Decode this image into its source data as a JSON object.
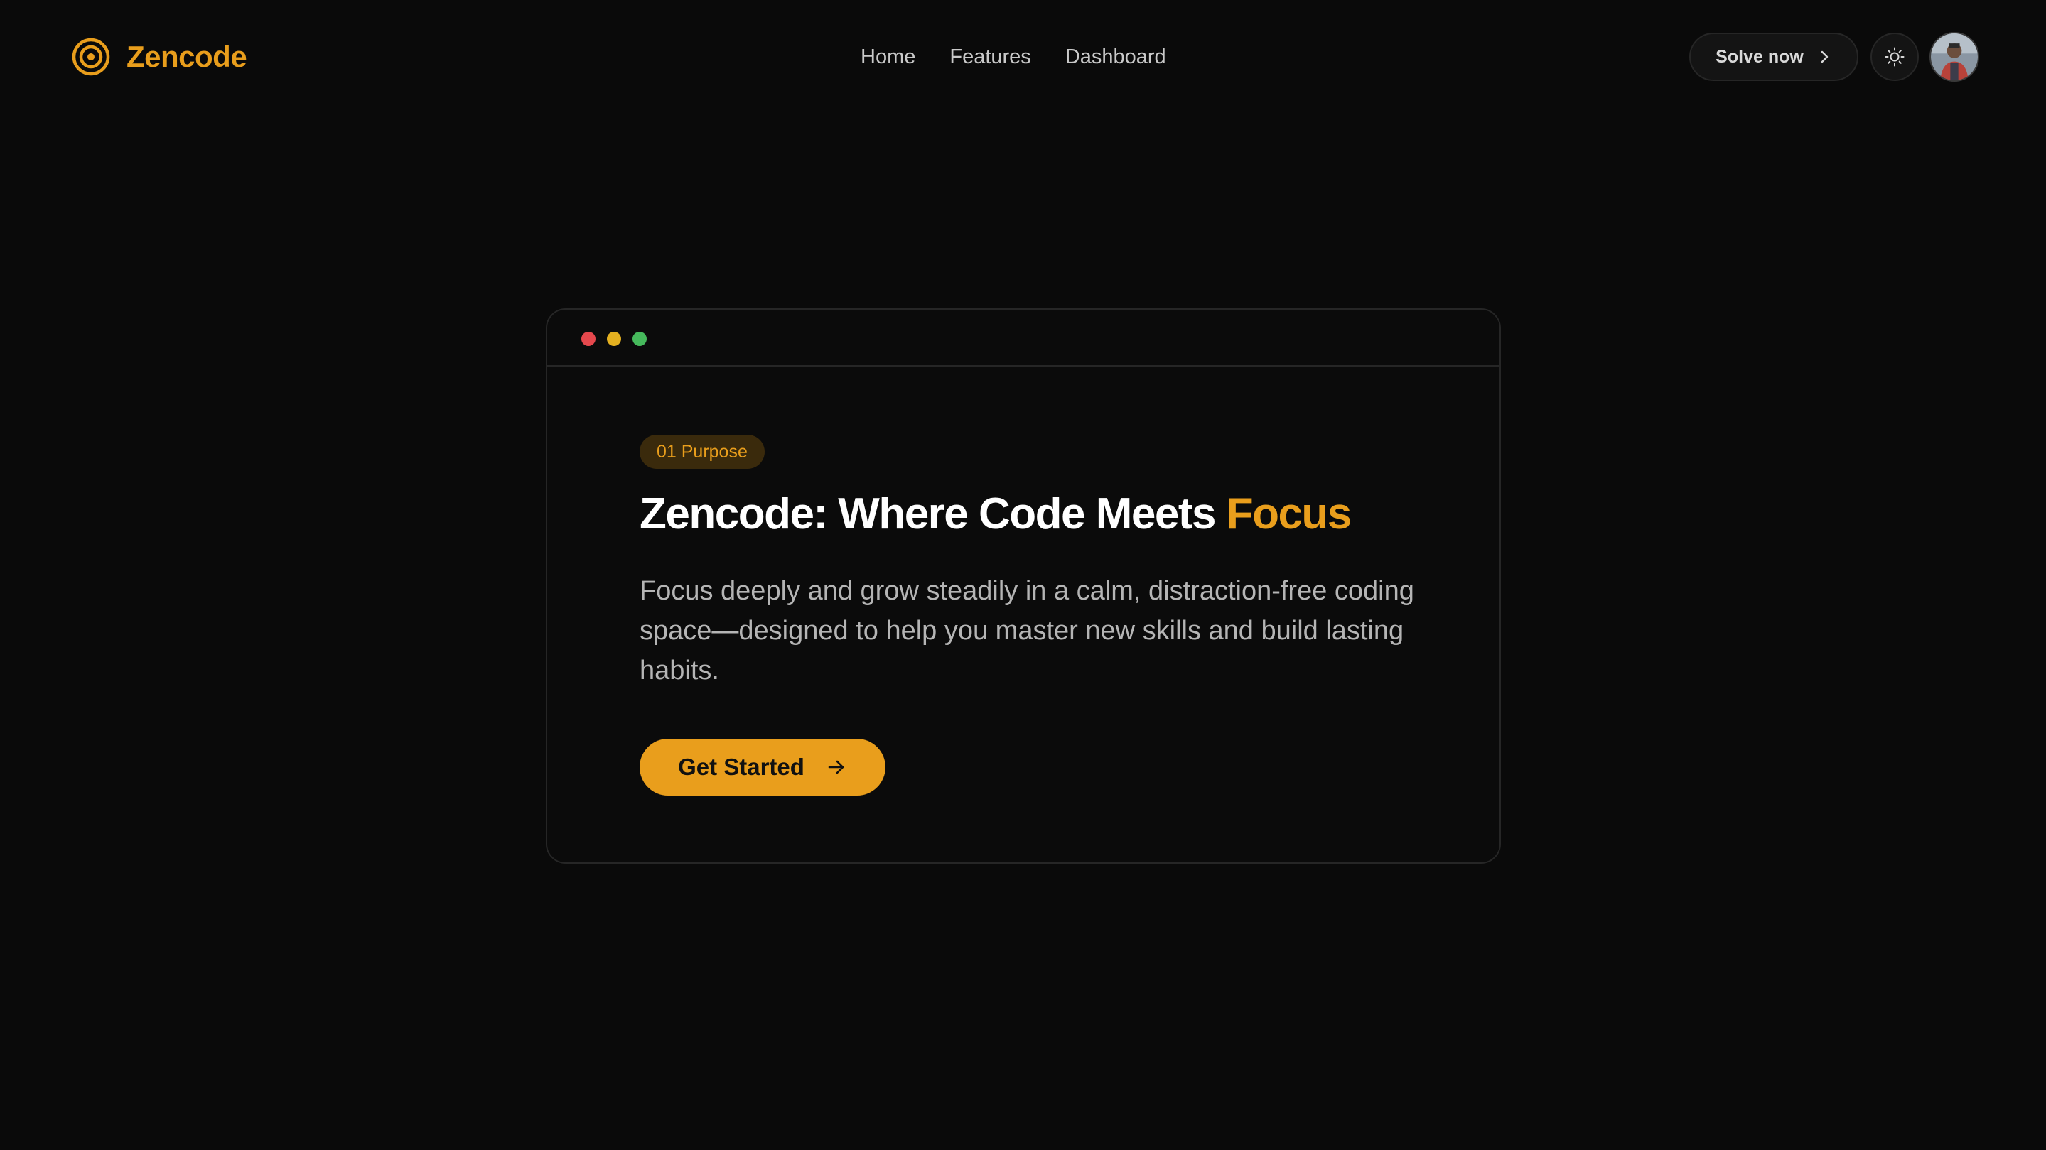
{
  "header": {
    "brand_name": "Zencode",
    "nav": [
      {
        "label": "Home"
      },
      {
        "label": "Features"
      },
      {
        "label": "Dashboard"
      }
    ],
    "solve_label": "Solve now",
    "icons": {
      "brand": "concentric-target-icon",
      "solve": "chevron-right-icon",
      "theme": "sun-icon",
      "avatar": "user-avatar"
    }
  },
  "hero": {
    "badge": "01 Purpose",
    "title_main": "Zencode: Where Code Meets ",
    "title_accent": "Focus",
    "description": "Focus deeply and grow steadily in a calm, distraction-free coding space—designed to help you master new skills and build lasting habits.",
    "cta_label": "Get Started",
    "cta_icon": "arrow-right-icon",
    "window_dots": [
      "red",
      "yellow",
      "green"
    ]
  },
  "colors": {
    "background": "#0a0a0a",
    "accent": "#e99e1c",
    "text": "#ffffff",
    "muted_text": "#b5b5b5",
    "border": "#262626",
    "dot_red": "#e5484d",
    "dot_yellow": "#e4b020",
    "dot_green": "#46b95c"
  }
}
